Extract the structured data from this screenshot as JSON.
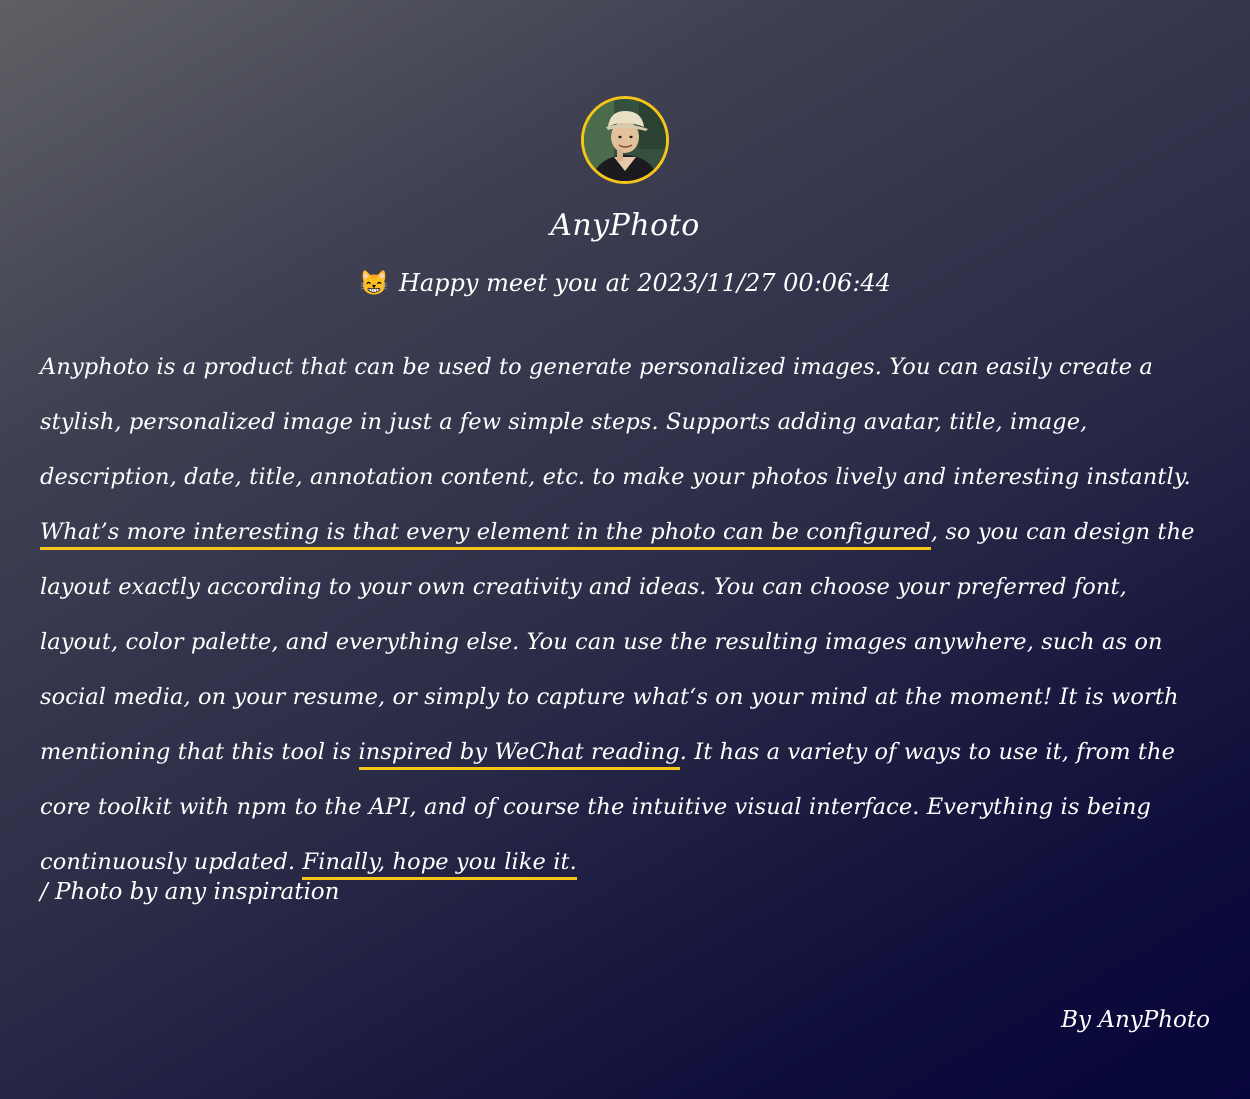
{
  "header": {
    "avatar_icon": "avatar-photo-icon",
    "title": "AnyPhoto",
    "greeting_emoji": "😸",
    "greeting": "Happy meet you at 2023/11/27 00:06:44"
  },
  "description": {
    "segments": [
      "Anyphoto is a product that can be used to generate personalized images. You can easily create a stylish, personalized image in just a few simple steps. Supports adding avatar, title, image, description, date, title, annotation content, etc. to make your photos lively and interesting instantly. ",
      "What’s more interesting is that every element in the photo can be configured",
      ", so you can design the layout exactly according to your own creativity and ideas. You can choose your preferred font, layout, color palette, and everything else. You can use the resulting images anywhere, such as on social media, on your resume, or simply to capture what‘s on your mind at the moment! It is worth mentioning that this tool is ",
      "inspired by WeChat reading",
      ". It has a variety of ways to use it, from the core toolkit with npm to the API, and of course the intuitive visual interface. Everything is being continuously updated. ",
      "Finally, hope you like it."
    ]
  },
  "footer": {
    "photo_credit": "/ Photo by any inspiration",
    "signature": "By AnyPhoto"
  },
  "colors": {
    "accent": "#f5c518",
    "text": "#ffffff",
    "background_start": "#5f6064",
    "background_end": "#07063a"
  }
}
